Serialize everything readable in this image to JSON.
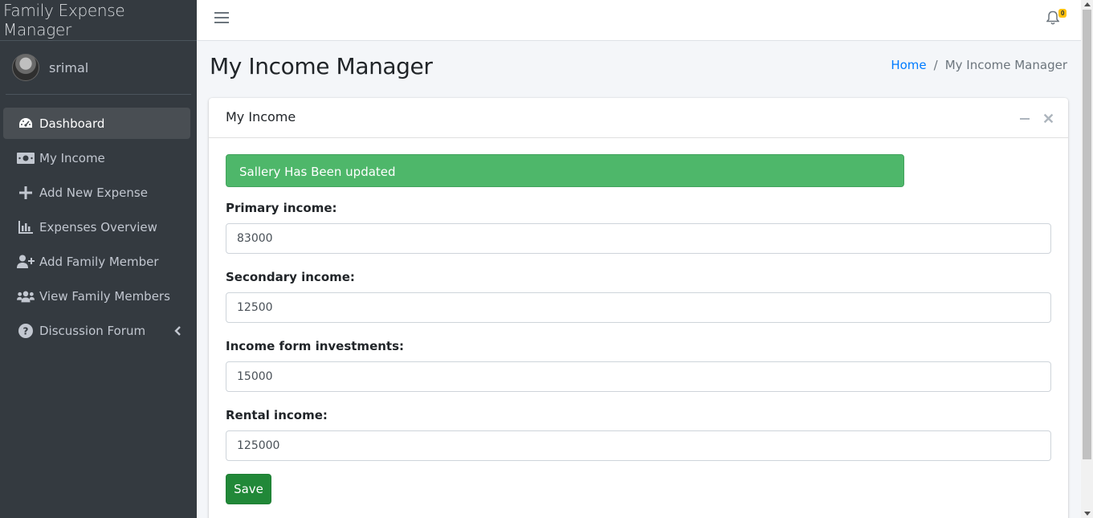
{
  "app": {
    "brand": "Family Expense Manager"
  },
  "user": {
    "name": "srimal"
  },
  "sidebar": {
    "items": [
      {
        "label": "Dashboard",
        "icon": "tachometer-icon",
        "active": true
      },
      {
        "label": "My Income",
        "icon": "money-bill-icon"
      },
      {
        "label": "Add New Expense",
        "icon": "plus-icon"
      },
      {
        "label": "Expenses Overview",
        "icon": "bar-chart-icon"
      },
      {
        "label": "Add Family Member",
        "icon": "user-plus-icon"
      },
      {
        "label": "View Family Members",
        "icon": "users-icon"
      },
      {
        "label": "Discussion Forum",
        "icon": "question-circle-icon",
        "expandable": true
      }
    ]
  },
  "topbar": {
    "notification_count": "0"
  },
  "header": {
    "title": "My Income Manager",
    "breadcrumb": {
      "home": "Home",
      "separator": "/",
      "current": "My Income Manager"
    }
  },
  "card": {
    "title": "My Income",
    "alert": "Sallery Has Been updated",
    "fields": [
      {
        "label": "Primary income:",
        "value": "83000"
      },
      {
        "label": "Secondary income:",
        "value": "12500"
      },
      {
        "label": "Income form investments:",
        "value": "15000"
      },
      {
        "label": "Rental income:",
        "value": "125000"
      }
    ],
    "save_label": "Save"
  },
  "colors": {
    "sidebar_bg": "#343a40",
    "alert_bg": "#4eb76a",
    "save_bg": "#218838",
    "link": "#007bff",
    "badge": "#ffc107"
  }
}
